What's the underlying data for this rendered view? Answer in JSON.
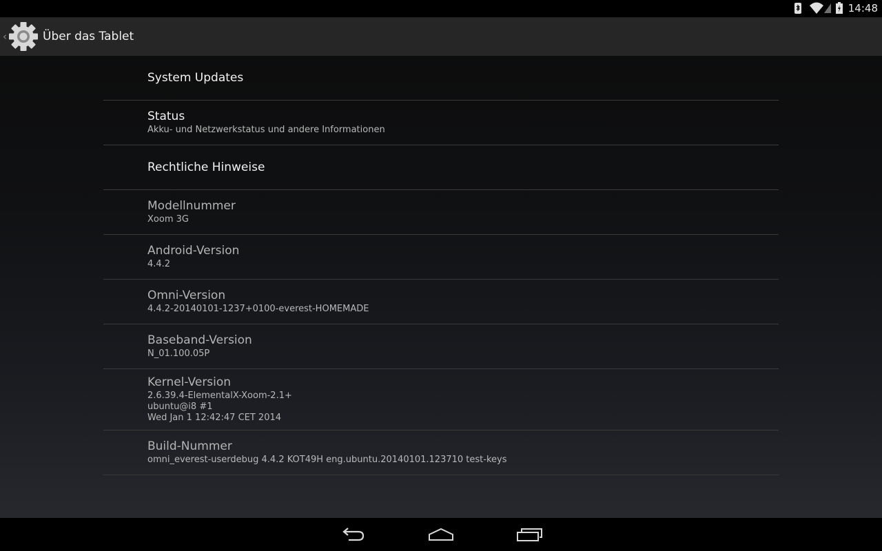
{
  "status_bar": {
    "time": "14:48",
    "icons": [
      "bluetooth-icon",
      "wifi-icon",
      "cell-signal-icon",
      "battery-icon"
    ]
  },
  "action_bar": {
    "title": "Über das Tablet",
    "app_icon": "settings-gear-icon"
  },
  "preferences": [
    {
      "title": "System Updates",
      "summary": "",
      "clickable": true
    },
    {
      "title": "Status",
      "summary": "Akku- und Netzwerkstatus und andere Informationen",
      "clickable": true
    },
    {
      "title": "Rechtliche Hinweise",
      "summary": "",
      "clickable": true
    },
    {
      "title": "Modellnummer",
      "summary": "Xoom 3G",
      "clickable": false
    },
    {
      "title": "Android-Version",
      "summary": "4.4.2",
      "clickable": false
    },
    {
      "title": "Omni-Version",
      "summary": "4.4.2-20140101-1237+0100-everest-HOMEMADE",
      "clickable": false
    },
    {
      "title": "Baseband-Version",
      "summary": "N_01.100.05P",
      "clickable": false
    },
    {
      "title": "Kernel-Version",
      "summary": "2.6.39.4-ElementalX-Xoom-2.1+\nubuntu@i8 #1\nWed Jan 1 12:42:47 CET 2014",
      "clickable": false
    },
    {
      "title": "Build-Nummer",
      "summary": "omni_everest-userdebug 4.4.2 KOT49H eng.ubuntu.20140101.123710 test-keys",
      "clickable": false
    }
  ],
  "nav_bar": {
    "buttons": [
      "back-icon",
      "home-icon",
      "recents-icon"
    ]
  }
}
